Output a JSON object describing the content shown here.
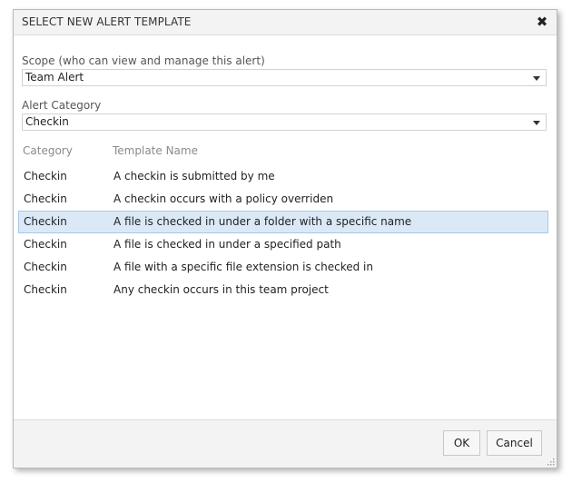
{
  "dialog": {
    "title": "SELECT NEW ALERT TEMPLATE",
    "close_icon": "close-icon"
  },
  "scope": {
    "label": "Scope (who can view and manage this alert)",
    "value": "Team Alert"
  },
  "category": {
    "label": "Alert Category",
    "value": "Checkin"
  },
  "table": {
    "headers": {
      "category": "Category",
      "template": "Template Name"
    },
    "selected_index": 2,
    "rows": [
      {
        "category": "Checkin",
        "template": "A checkin is submitted by me"
      },
      {
        "category": "Checkin",
        "template": "A checkin occurs with a policy overriden"
      },
      {
        "category": "Checkin",
        "template": "A file is checked in under a folder with a specific name"
      },
      {
        "category": "Checkin",
        "template": "A file is checked in under a specified path"
      },
      {
        "category": "Checkin",
        "template": "A file with a specific file extension is checked in"
      },
      {
        "category": "Checkin",
        "template": "Any checkin occurs in this team project"
      }
    ]
  },
  "footer": {
    "ok_label": "OK",
    "cancel_label": "Cancel"
  },
  "colors": {
    "selected_row_bg": "#dbe9f7",
    "selected_row_border": "#a9c7e8"
  }
}
